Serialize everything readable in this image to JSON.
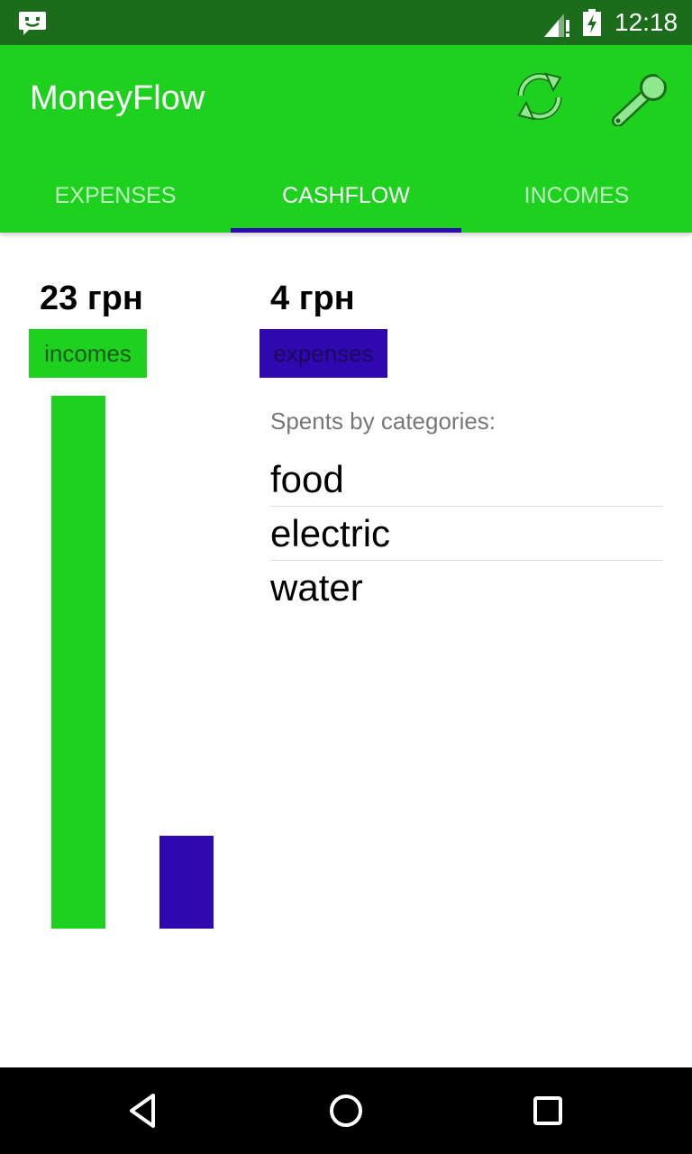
{
  "status_bar": {
    "time": "12:18",
    "icons": [
      "message-icon",
      "signal-icon",
      "battery-icon"
    ]
  },
  "app_bar": {
    "title": "MoneyFlow",
    "actions": [
      "refresh-icon",
      "wrench-icon"
    ]
  },
  "tabs": [
    {
      "label": "EXPENSES",
      "active": false
    },
    {
      "label": "CASHFLOW",
      "active": true
    },
    {
      "label": "INCOMES",
      "active": false
    }
  ],
  "summary": {
    "income_amount": "23 грн",
    "income_label": "incomes",
    "expense_amount": "4 грн",
    "expense_label": "expenses"
  },
  "chart_data": {
    "type": "bar",
    "categories": [
      "incomes",
      "expenses"
    ],
    "values": [
      23,
      4
    ],
    "colors": [
      "#1fd11f",
      "#3008b0"
    ]
  },
  "categories": {
    "heading": "Spents by categories:",
    "items": [
      "food",
      "electric",
      "water"
    ]
  },
  "nav_bar": {
    "buttons": [
      "back-icon",
      "home-icon",
      "recent-apps-icon"
    ]
  },
  "colors": {
    "status_bar": "#1b6d1b",
    "primary": "#1fd11f",
    "accent": "#3008b0"
  }
}
